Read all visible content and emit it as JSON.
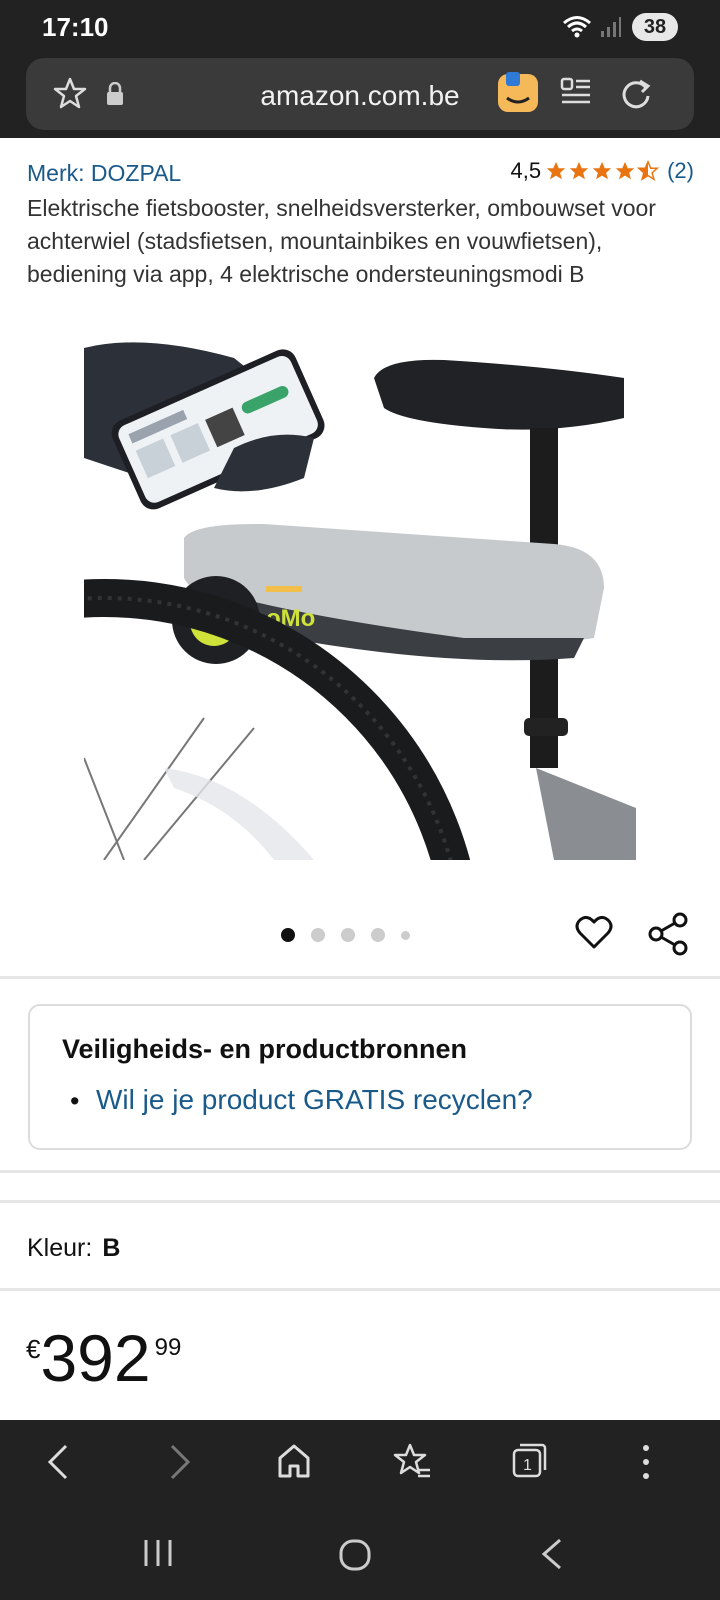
{
  "status": {
    "time": "17:10",
    "battery": "38"
  },
  "browser": {
    "url": "amazon.com.be"
  },
  "product": {
    "brand": "Merk: DOZPAL",
    "rating_value": "4,5",
    "rating_count": "(2)",
    "title": "Elektrische fietsbooster, snelheidsversterker, ombouwset voor achterwiel (stadsfietsen, mountainbikes en vouwfietsen), bediening via app, 4 elektrische ondersteuningsmodi B",
    "image_label": "BooMo"
  },
  "carousel": {
    "total": 5,
    "active": 1
  },
  "safety": {
    "heading": "Veiligheids- en productbronnen",
    "link": "Wil je je product GRATIS recyclen?"
  },
  "color": {
    "label": "Kleur:",
    "value": "B"
  },
  "price": {
    "currency": "€",
    "whole": "392",
    "fraction": "99"
  },
  "colors": {
    "link": "#1a5a8a",
    "star": "#e87511",
    "bar": "#222222"
  },
  "icons": [
    "wifi-icon",
    "signal-icon",
    "star-outline-icon",
    "lock-icon",
    "amazon-app-icon",
    "reader-icon",
    "refresh-icon",
    "heart-icon",
    "share-icon",
    "back-icon",
    "forward-icon",
    "home-icon",
    "bookmarks-icon",
    "tabs-icon",
    "more-icon",
    "recent-apps-icon",
    "home-circle-icon",
    "system-back-icon"
  ]
}
